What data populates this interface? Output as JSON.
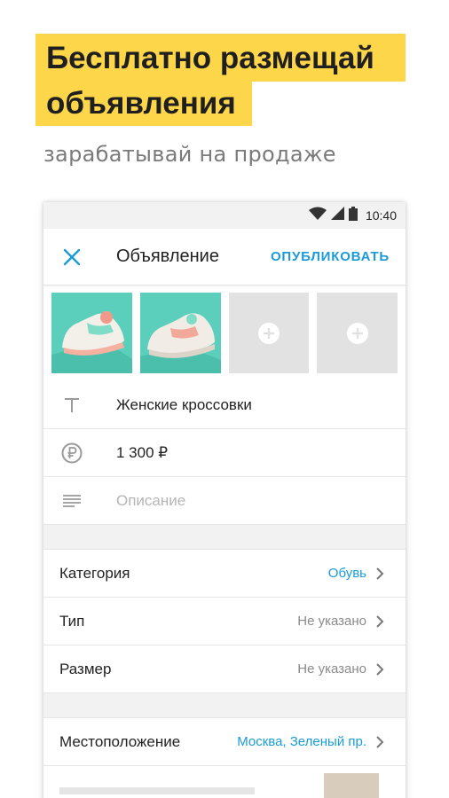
{
  "promo": {
    "headline_line1": "Бесплатно размещай",
    "headline_line2": "объявления",
    "subtitle": "зарабатывай на продаже",
    "highlight_color": "#fdd64a"
  },
  "statusbar": {
    "time": "10:40"
  },
  "appbar": {
    "title": "Объявление",
    "publish_label": "ОПУБЛИКОВАТЬ",
    "accent_color": "#1a9bd7"
  },
  "photos": {
    "filled_count": 2,
    "empty_count": 2
  },
  "fields": {
    "title_value": "Женские кроссовки",
    "price_value": "1 300 ₽",
    "description_placeholder": "Описание"
  },
  "params": [
    {
      "label": "Категория",
      "value": "Обувь",
      "accent": true
    },
    {
      "label": "Тип",
      "value": "Не указано",
      "accent": false
    },
    {
      "label": "Размер",
      "value": "Не указано",
      "accent": false
    }
  ],
  "location": {
    "label": "Местоположение",
    "value": "Москва, Зеленый пр."
  },
  "icons": {
    "close": "close-icon",
    "title": "text-icon",
    "price": "ruble-icon",
    "description": "lines-icon",
    "chevron": "chevron-right-icon",
    "add_photo": "plus-circle-icon"
  }
}
